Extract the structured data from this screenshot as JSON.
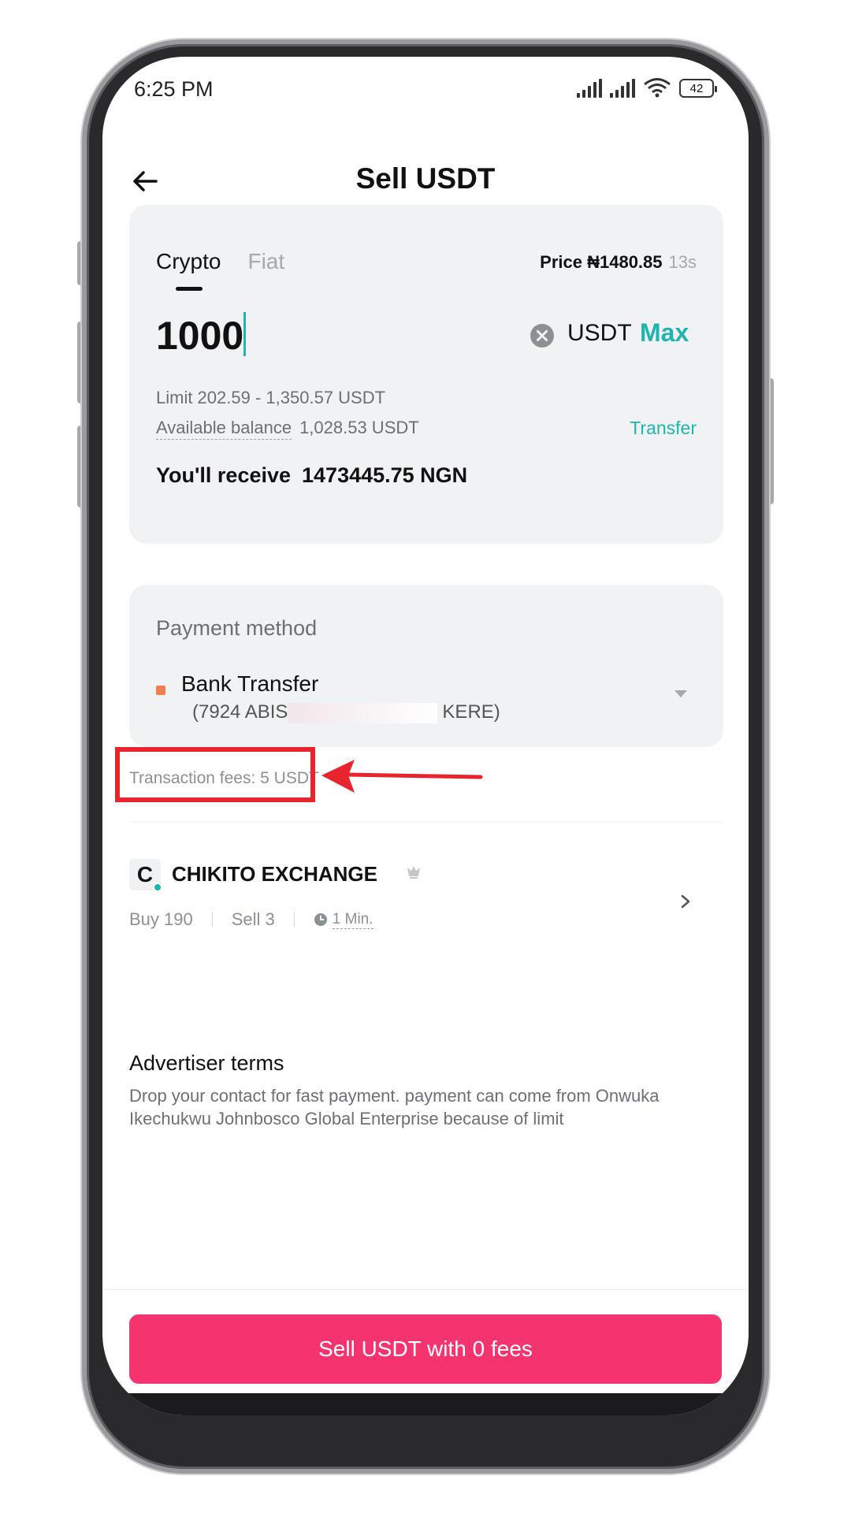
{
  "status_bar": {
    "time": "6:25 PM",
    "battery": "42"
  },
  "header": {
    "title": "Sell USDT",
    "back_icon": "arrow-left-icon"
  },
  "amount_card": {
    "tabs": [
      {
        "label": "Crypto",
        "active": true
      },
      {
        "label": "Fiat",
        "active": false
      }
    ],
    "price_label": "Price ₦1480.85",
    "price_countdown": "13s",
    "amount_value": "1000",
    "unit": "USDT",
    "max_label": "Max",
    "limit_text": "Limit 202.59 - 1,350.57 USDT",
    "balance_label": "Available balance",
    "balance_value": "1,028.53 USDT",
    "transfer_label": "Transfer",
    "receive_label": "You'll receive",
    "receive_value": "1473445.75 NGN"
  },
  "payment": {
    "label": "Payment method",
    "method": "Bank Transfer",
    "account_prefix": "(7924 ABIS",
    "account_suffix": "KERE)"
  },
  "fees_text": "Transaction fees: 5 USDT",
  "merchant": {
    "avatar_letter": "C",
    "name": "CHIKITO EXCHANGE",
    "buy": "Buy 190",
    "sell": "Sell 3",
    "time": "1 Min."
  },
  "terms": {
    "title": "Advertiser terms",
    "body": "Drop your contact for fast payment. payment can come from Onwuka Ikechukwu Johnbosco Global Enterprise because of limit"
  },
  "action": {
    "sell_label": "Sell USDT with 0 fees"
  },
  "colors": {
    "accent": "#1fb4b0",
    "primary_button": "#f5336f",
    "annotation": "#e8242e"
  }
}
